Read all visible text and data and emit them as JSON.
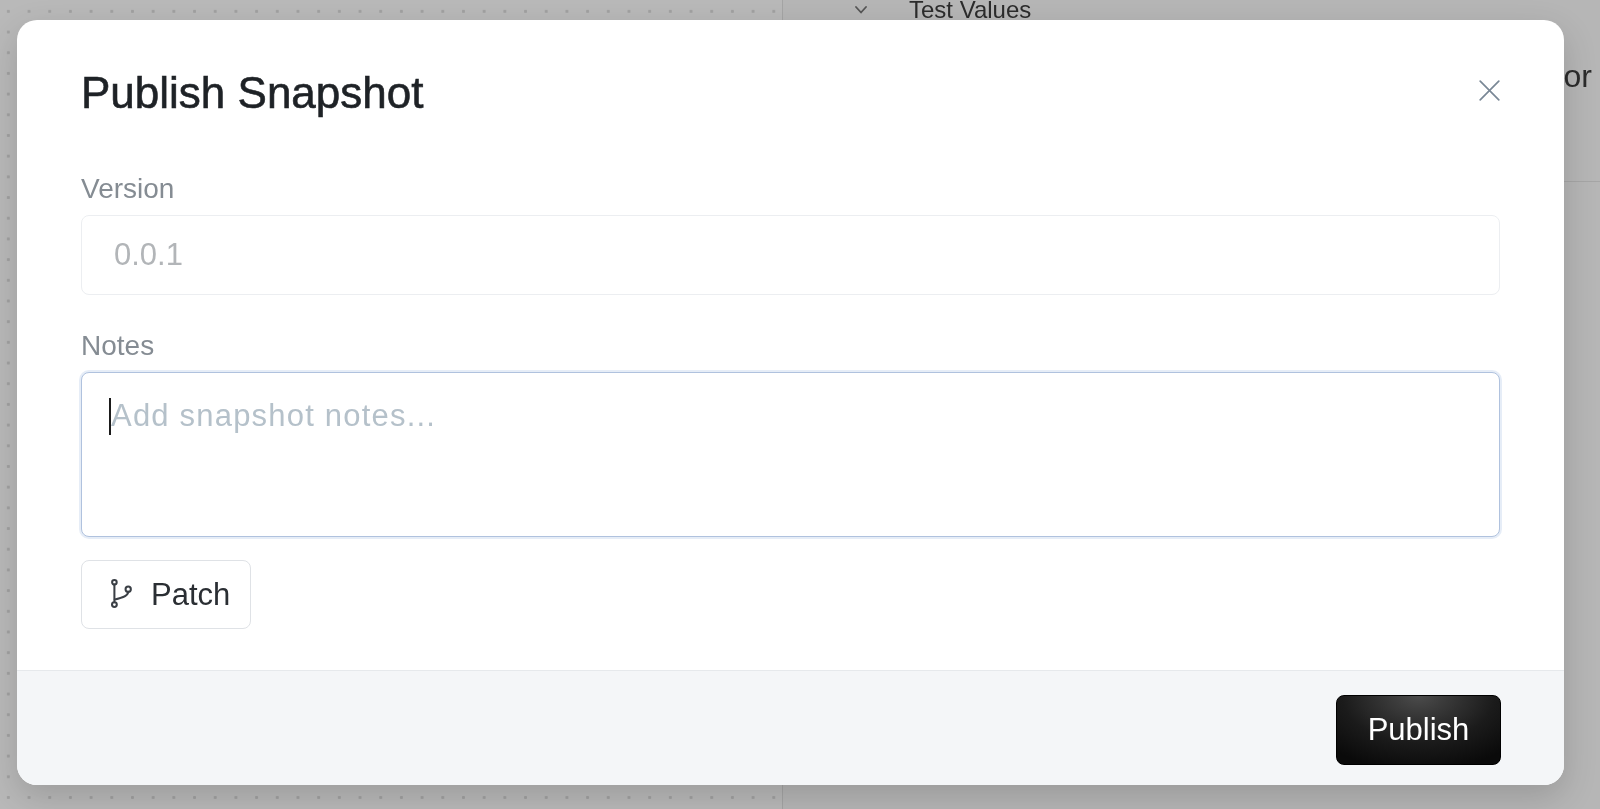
{
  "app_background": {
    "side_panel": {
      "tree_item": {
        "label": "Test Values"
      },
      "partial_label": "or"
    }
  },
  "dialog": {
    "title": "Publish Snapshot",
    "fields": [
      {
        "kind": "input",
        "label": "Version",
        "value": "0.0.1",
        "disabled": true,
        "focused": false
      },
      {
        "kind": "textarea",
        "label": "Notes",
        "placeholder": "Add snapshot notes...",
        "disabled": false,
        "focused": true
      }
    ],
    "version_type_button": {
      "label": "Patch"
    },
    "footer_buttons": [
      {
        "label": "Publish",
        "kind": "primary"
      }
    ]
  }
}
